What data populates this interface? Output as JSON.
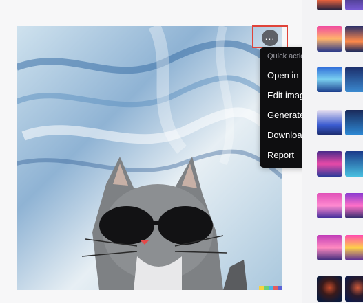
{
  "menu": {
    "header": "Quick actions",
    "items": [
      {
        "label": "Open in new tab"
      },
      {
        "label": "Edit image"
      },
      {
        "label": "Generate variations"
      },
      {
        "label": "Download"
      },
      {
        "label": "Report"
      }
    ]
  },
  "more_button": {
    "icon": "ellipsis-icon",
    "glyph": "..."
  },
  "image": {
    "subject": "cat-with-sunglasses-painting"
  },
  "colors": {
    "highlight": "#e0443a",
    "menu_bg": "#0e0e10",
    "menu_text": "#ffffff",
    "menu_header": "#9a9aa2"
  }
}
